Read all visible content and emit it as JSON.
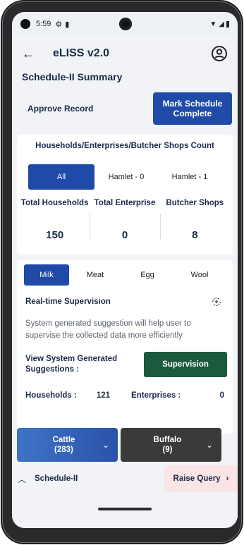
{
  "status_bar": {
    "time": "5:59"
  },
  "app_bar": {
    "title": "eLISS v2.0"
  },
  "page": {
    "section_title": "Schedule-II Summary"
  },
  "actions": {
    "approve_label": "Approve Record",
    "mark_complete_label": "Mark Schedule Complete"
  },
  "counts_card": {
    "title": "Households/Enterprises/Butcher Shops Count",
    "tabs": [
      "All",
      "Hamlet - 0",
      "Hamlet - 1"
    ],
    "stats": [
      {
        "label": "Total Households",
        "value": "150"
      },
      {
        "label": "Total Enterprise",
        "value": "0"
      },
      {
        "label": "Butcher Shops",
        "value": "8"
      }
    ]
  },
  "supervision": {
    "tabs": [
      "Milk",
      "Meat",
      "Egg",
      "Wool"
    ],
    "title": "Real-time Supervision",
    "suggestion": "System generated suggestion will help user to supervise the collected data more efficiently",
    "view_label": "View System Generated Suggestions :",
    "button_label": "Supervision",
    "households_label": "Households :",
    "households_value": "121",
    "enterprises_label": "Enterprises :",
    "enterprises_value": "0"
  },
  "animals": [
    {
      "name": "Cattle",
      "count": "(283)"
    },
    {
      "name": "Buffalo",
      "count": "(9)"
    }
  ],
  "bottom": {
    "schedule_label": "Schedule-II",
    "raise_query_label": "Raise Query"
  },
  "colors": {
    "primary": "#1f4aa8",
    "supervision_green": "#1c5a3c",
    "raise_bg": "#fbe4e6"
  }
}
